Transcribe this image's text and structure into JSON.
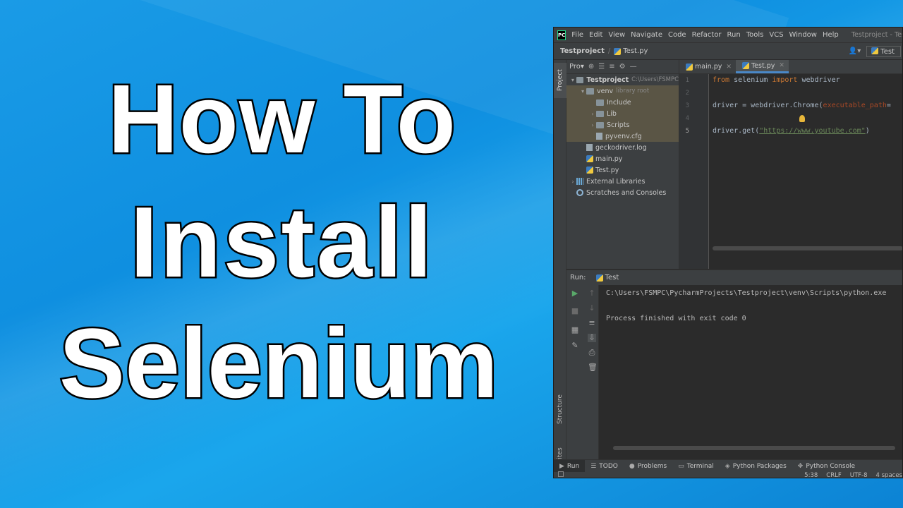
{
  "thumbnail": {
    "title_lines": [
      "How To",
      "Install",
      "Selenium"
    ]
  },
  "ide": {
    "menu": [
      "File",
      "Edit",
      "View",
      "Navigate",
      "Code",
      "Refactor",
      "Run",
      "Tools",
      "VCS",
      "Window",
      "Help"
    ],
    "window_title": "Testproject - Test.py",
    "app_logo": "PC",
    "breadcrumb": {
      "project": "Testproject",
      "file": "Test.py"
    },
    "run_config": "Test",
    "side_tabs": {
      "project": "Project",
      "structure": "Structure",
      "favorites": "Favorites"
    },
    "project_panel": {
      "header": "Pro▾",
      "tree": [
        {
          "label": "Testproject",
          "note": "C:\\Users\\FSMPC",
          "indent": 0,
          "arrow": "▾",
          "icon": "folder"
        },
        {
          "label": "venv",
          "note": "library root",
          "indent": 1,
          "arrow": "▾",
          "icon": "folder"
        },
        {
          "label": "Include",
          "note": "",
          "indent": 2,
          "arrow": "",
          "icon": "folder"
        },
        {
          "label": "Lib",
          "note": "",
          "indent": 2,
          "arrow": "›",
          "icon": "folder"
        },
        {
          "label": "Scripts",
          "note": "",
          "indent": 2,
          "arrow": "›",
          "icon": "folder"
        },
        {
          "label": "pyvenv.cfg",
          "note": "",
          "indent": 2,
          "arrow": "",
          "icon": "file"
        },
        {
          "label": "geckodriver.log",
          "note": "",
          "indent": 1,
          "arrow": "",
          "icon": "file"
        },
        {
          "label": "main.py",
          "note": "",
          "indent": 1,
          "arrow": "",
          "icon": "py"
        },
        {
          "label": "Test.py",
          "note": "",
          "indent": 1,
          "arrow": "",
          "icon": "py"
        },
        {
          "label": "External Libraries",
          "note": "",
          "indent": 0,
          "arrow": "›",
          "icon": "lib"
        },
        {
          "label": "Scratches and Consoles",
          "note": "",
          "indent": 0,
          "arrow": "",
          "icon": "scratch"
        }
      ]
    },
    "editor_tabs": [
      {
        "label": "main.py",
        "active": false
      },
      {
        "label": "Test.py",
        "active": true
      }
    ],
    "code": {
      "line_numbers": [
        "1",
        "2",
        "3",
        "4",
        "5"
      ],
      "line1_kw1": "from",
      "line1_mid": " selenium ",
      "line1_kw2": "import",
      "line1_end": " webdriver",
      "line3_start": "driver = webdriver.Chrome(",
      "line3_param": "executable_path",
      "line3_end": "=",
      "line5_start": "driver.get(",
      "line5_str": "\"https://www.youtube.com\"",
      "line5_end": ")"
    },
    "run_panel": {
      "label": "Run:",
      "tab": "Test",
      "output": [
        "C:\\Users\\FSMPC\\PycharmProjects\\Testproject\\venv\\Scripts\\python.exe",
        "",
        "Process finished with exit code 0"
      ]
    },
    "bottom_tools": [
      {
        "label": "Run",
        "sym": "▶"
      },
      {
        "label": "TODO",
        "sym": "☰"
      },
      {
        "label": "Problems",
        "sym": "●"
      },
      {
        "label": "Terminal",
        "sym": "▭"
      },
      {
        "label": "Python Packages",
        "sym": "◈"
      },
      {
        "label": "Python Console",
        "sym": "✥"
      }
    ],
    "status": {
      "position": "5:38",
      "line_sep": "CRLF",
      "encoding": "UTF-8",
      "indent": "4 spaces"
    }
  }
}
